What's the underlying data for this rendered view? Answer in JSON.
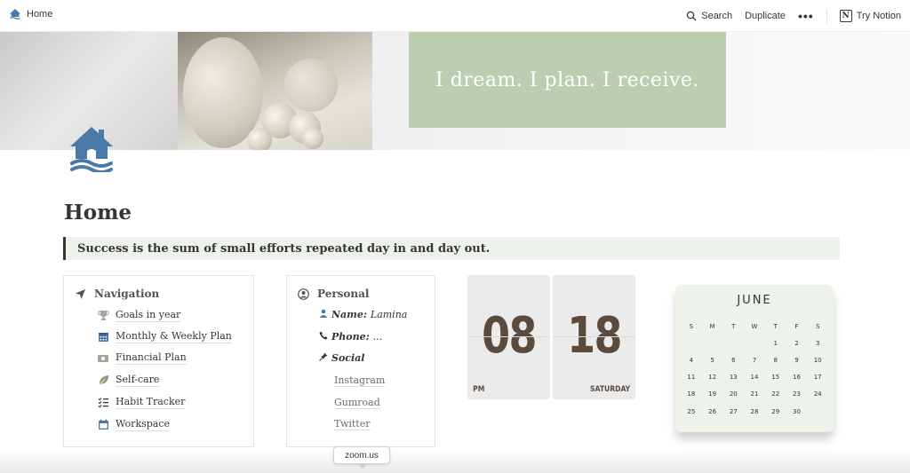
{
  "topbar": {
    "breadcrumb": "Home",
    "search_label": "Search",
    "duplicate_label": "Duplicate",
    "more_label": "•••",
    "try_notion_label": "Try Notion",
    "notion_logo": "N"
  },
  "cover": {
    "quote": "I dream. I plan. I receive.",
    "quote_bg": "#bccdb0"
  },
  "page": {
    "title": "Home",
    "callout": "Success is the sum of small efforts repeated day in and day out.",
    "icon": "house-icon",
    "accent": "#4a7aa8"
  },
  "navigation": {
    "heading": "Navigation",
    "items": [
      {
        "label": "Goals in year",
        "icon": "trophy-icon"
      },
      {
        "label": "Monthly & Weekly Plan",
        "icon": "calendar-grid-icon"
      },
      {
        "label": "Financial Plan",
        "icon": "money-icon"
      },
      {
        "label": "Self-care",
        "icon": "leaf-icon"
      },
      {
        "label": "Habit Tracker",
        "icon": "checklist-icon"
      },
      {
        "label": "Workspace",
        "icon": "calendar-icon"
      }
    ]
  },
  "personal": {
    "heading": "Personal",
    "name_label": "Name:",
    "name_value": "Lamina",
    "phone_label": "Phone:",
    "phone_value": "...",
    "social_label": "Social",
    "links": [
      "Instagram",
      "Gumroad",
      "Twitter"
    ]
  },
  "clock": {
    "hours": "08",
    "minutes": "18",
    "period": "PM",
    "day": "SATURDAY",
    "color": "#5a4b3d"
  },
  "calendar": {
    "month": "JUNE",
    "weekdays": [
      "S",
      "M",
      "T",
      "W",
      "T",
      "F",
      "S"
    ],
    "weeks": [
      [
        "",
        "",
        "",
        "",
        "1",
        "2",
        "3"
      ],
      [
        "4",
        "5",
        "6",
        "7",
        "8",
        "9",
        "10"
      ],
      [
        "11",
        "12",
        "13",
        "14",
        "15",
        "16",
        "17"
      ],
      [
        "18",
        "19",
        "20",
        "21",
        "22",
        "23",
        "24"
      ],
      [
        "25",
        "26",
        "27",
        "28",
        "29",
        "30",
        ""
      ]
    ],
    "bg": "#edf2ea"
  },
  "tooltip": {
    "text": "zoom.us"
  }
}
